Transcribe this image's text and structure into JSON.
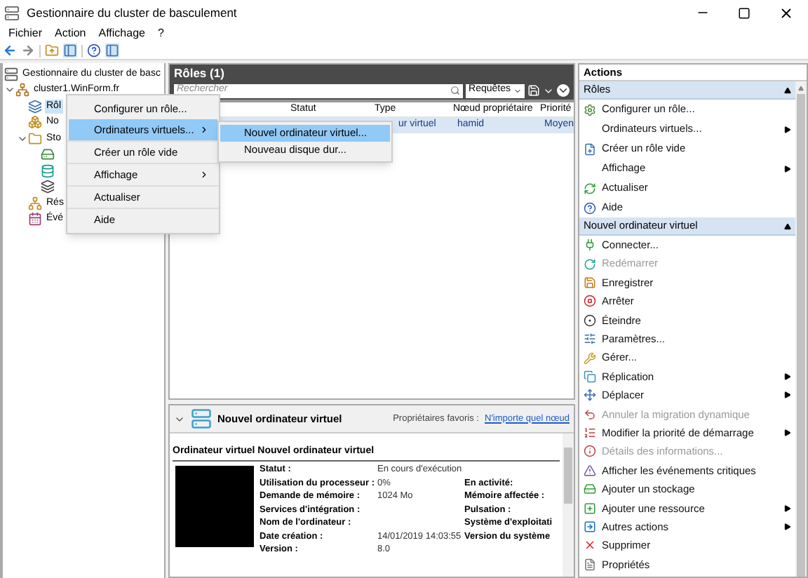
{
  "window": {
    "title": "Gestionnaire du cluster de basculement"
  },
  "menu": [
    "Fichier",
    "Action",
    "Affichage",
    "?"
  ],
  "tree": [
    {
      "label": "Gestionnaire du cluster de basc",
      "children": [
        {
          "label": "cluster1.WinForm.fr",
          "expanded": true,
          "children": [
            {
              "label": "Rôl",
              "selected": true
            },
            {
              "label": "No",
              "selected": false
            },
            {
              "label": "Sto",
              "expanded": true,
              "selected": false,
              "children": [
                {
                  "selected": false
                },
                {
                  "selected": false
                },
                {
                  "selected": false
                }
              ]
            },
            {
              "label": "Rés",
              "selected": false
            },
            {
              "label": "Évé",
              "selected": false
            }
          ]
        }
      ]
    }
  ],
  "roles": {
    "title": "Rôles (1)",
    "search": {
      "placeholder": "Rechercher"
    },
    "queries_button": "Requêtes",
    "columns": [
      "Statut",
      "Type",
      "Nœud propriétaire",
      "Priorité"
    ],
    "rows": [
      {
        "type": "ur virtuel",
        "owner": "hamid",
        "priority": "Moyen",
        "selected": true
      }
    ]
  },
  "context_menu": [
    {
      "label": "Configurer un rôle...",
      "selected": false,
      "submenu": false
    },
    {
      "label": "Ordinateurs virtuels...",
      "selected": true,
      "submenu": true
    },
    {
      "label": "Créer un rôle vide",
      "selected": false,
      "submenu": false
    },
    {
      "label": "Affichage",
      "selected": false,
      "submenu": true
    },
    {
      "label": "Actualiser",
      "selected": false,
      "submenu": false
    },
    {
      "label": "Aide",
      "selected": false,
      "submenu": false
    }
  ],
  "submenu": [
    {
      "label": "Nouvel ordinateur virtuel...",
      "selected": true
    },
    {
      "label": "Nouveau disque dur...",
      "selected": false
    }
  ],
  "details": {
    "title": "Nouvel ordinateur virtuel",
    "owners_label": "Propriétaires favoris :",
    "owners_link": "N'importe quel nœud",
    "section_title": "Ordinateur virtuel Nouvel ordinateur virtuel",
    "rows": [
      {
        "label": "Statut :",
        "value": "En cours d'exécution"
      },
      {
        "label": "Utilisation du processeur :",
        "value": "0%",
        "label_2": "En activité:"
      },
      {
        "label": "Demande de mémoire :",
        "value": "1024 Mo",
        "label_2": "Mémoire affectée :"
      },
      {
        "label": "Services d'intégration :",
        "label_2": "Pulsation :"
      },
      {
        "label": "Nom de l'ordinateur :",
        "label_2": "Système d'exploitati"
      },
      {
        "label": "Date création :",
        "value": "14/01/2019 14:03:55",
        "label_2": "Version du système"
      },
      {
        "label": "Version :",
        "value": "8.0"
      }
    ]
  },
  "actions": {
    "title": "Actions",
    "sections": [
      {
        "title": "Rôles",
        "expanded": true,
        "items": [
          {
            "label": "Configurer un rôle...",
            "disabled": false,
            "submenu": false
          },
          {
            "label": "Ordinateurs virtuels...",
            "disabled": false,
            "submenu": true
          },
          {
            "label": "Créer un rôle vide",
            "disabled": false,
            "submenu": false
          },
          {
            "label": "Affichage",
            "disabled": false,
            "submenu": true
          },
          {
            "label": "Actualiser",
            "disabled": false,
            "submenu": false
          },
          {
            "label": "Aide",
            "disabled": false,
            "submenu": false
          }
        ]
      },
      {
        "title": "Nouvel ordinateur virtuel",
        "expanded": true,
        "items": [
          {
            "label": "Connecter...",
            "disabled": false,
            "submenu": false
          },
          {
            "label": "Redémarrer",
            "disabled": true,
            "submenu": false
          },
          {
            "label": "Enregistrer",
            "disabled": false,
            "submenu": false
          },
          {
            "label": "Arrêter",
            "disabled": false,
            "submenu": false
          },
          {
            "label": "Éteindre",
            "disabled": false,
            "submenu": false
          },
          {
            "label": "Paramètres...",
            "disabled": false,
            "submenu": false
          },
          {
            "label": "Gérer...",
            "disabled": false,
            "submenu": false
          },
          {
            "label": "Réplication",
            "disabled": false,
            "submenu": true
          },
          {
            "label": "Déplacer",
            "disabled": false,
            "submenu": true
          },
          {
            "label": "Annuler la migration dynamique",
            "disabled": true,
            "submenu": false
          },
          {
            "label": "Modifier la priorité de démarrage",
            "disabled": false,
            "submenu": true
          },
          {
            "label": "Détails des informations...",
            "disabled": true,
            "submenu": false
          },
          {
            "label": "Afficher les événements critiques",
            "disabled": false,
            "submenu": false
          },
          {
            "label": "Ajouter un stockage",
            "disabled": false,
            "submenu": false
          },
          {
            "label": "Ajouter une ressource",
            "disabled": false,
            "submenu": true
          },
          {
            "label": "Autres actions",
            "disabled": false,
            "submenu": true
          },
          {
            "label": "Supprimer",
            "disabled": false,
            "submenu": false
          },
          {
            "label": "Propriétés",
            "disabled": false,
            "submenu": false
          }
        ]
      }
    ]
  }
}
